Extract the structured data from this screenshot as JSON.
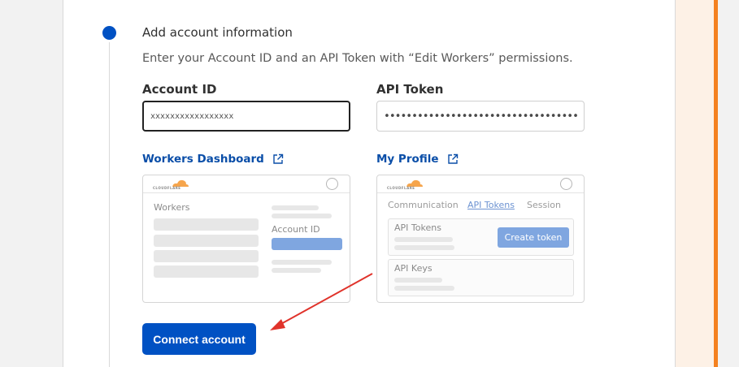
{
  "step": {
    "title": "Add account information",
    "description": "Enter your Account ID and an API Token with “Edit Workers” permissions."
  },
  "account_id": {
    "label": "Account ID",
    "value": "xxxxxxxxxxxxxxxxx"
  },
  "api_token": {
    "label": "API Token",
    "value": "••••••••••••••••••••••••••••••••••••••••"
  },
  "workers_dashboard": {
    "link_label": "Workers Dashboard",
    "logo_text": "CLOUDFLARE",
    "workers_heading": "Workers",
    "account_id_label": "Account ID"
  },
  "my_profile": {
    "link_label": "My Profile",
    "logo_text": "CLOUDFLARE",
    "tabs": [
      "Communication",
      "API Tokens",
      "Session"
    ],
    "active_tab": "API Tokens",
    "api_tokens_heading": "API Tokens",
    "create_token_label": "Create token",
    "api_keys_heading": "API Keys"
  },
  "connect_button_label": "Connect account",
  "colors": {
    "primary": "#0051c3",
    "link": "#0a4ea8",
    "accent": "#f48120",
    "preview_blue": "#7fa6e0",
    "annotation_arrow": "#e0332b"
  },
  "icons": {
    "step_marker": "step-dot-icon",
    "external_link": "external-link-icon",
    "logo": "cloudflare-logo-icon",
    "avatar": "avatar-icon",
    "annotation": "red-arrow-icon"
  }
}
